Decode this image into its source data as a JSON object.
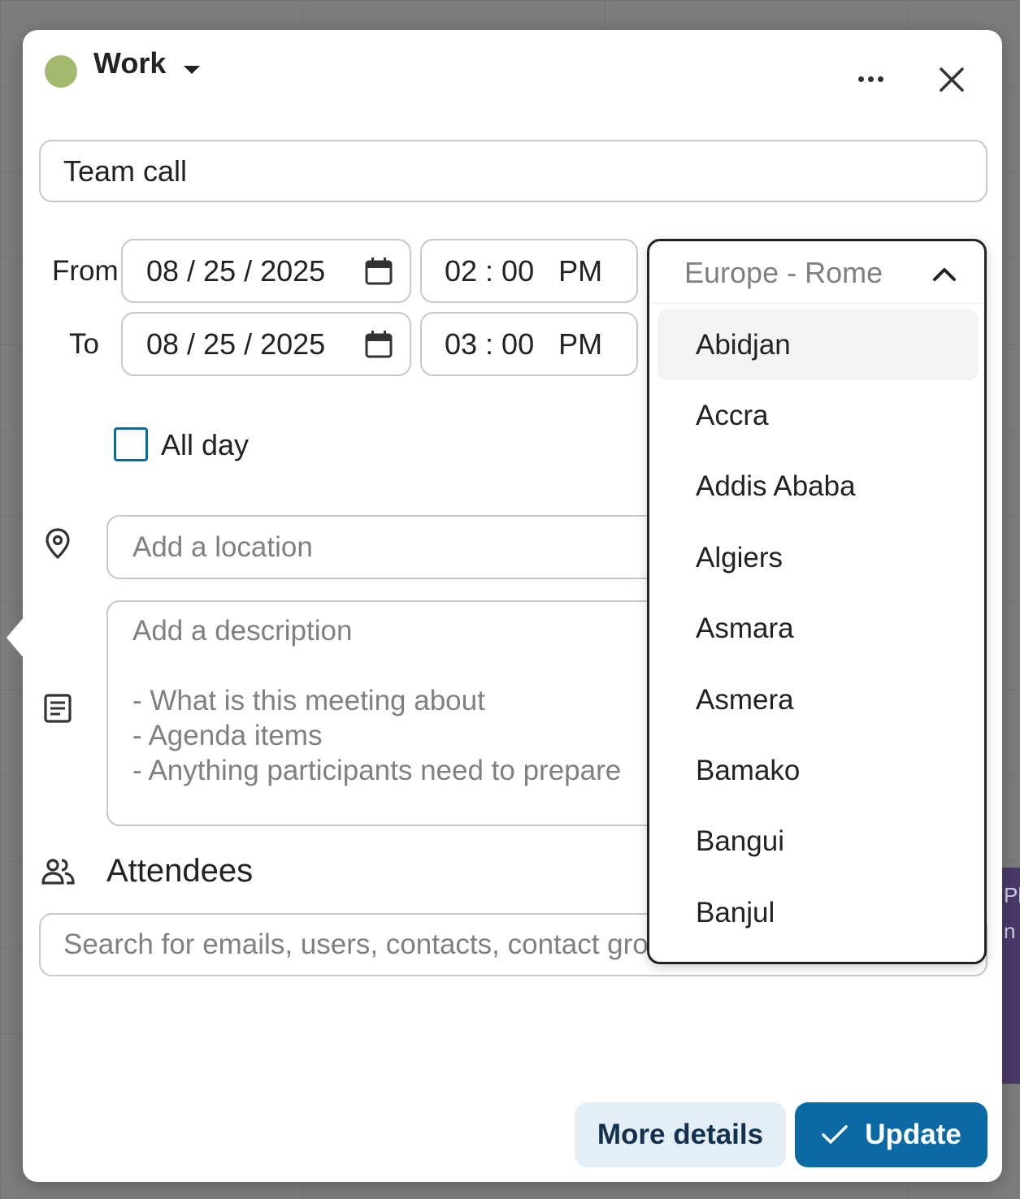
{
  "background": {
    "event_fragment": "Pl n"
  },
  "header": {
    "calendar_name": "Work",
    "calendar_color": "#a3b96e",
    "more_icon": "more-horizontal-icon",
    "close_icon": "close-icon"
  },
  "event": {
    "title": "Team call"
  },
  "from": {
    "label": "From",
    "date": "08 / 25 / 2025",
    "time": "02 : 00   PM"
  },
  "to": {
    "label": "To",
    "date": "08 / 25 / 2025",
    "time": "03 : 00   PM"
  },
  "timezone": {
    "value": "Europe - Rome",
    "options": [
      "Abidjan",
      "Accra",
      "Addis Ababa",
      "Algiers",
      "Asmara",
      "Asmera",
      "Bamako",
      "Bangui",
      "Banjul"
    ]
  },
  "all_day": {
    "label": "All day",
    "checked": false
  },
  "location": {
    "placeholder": "Add a location"
  },
  "description": {
    "placeholder_lines": [
      "Add a description",
      "",
      "- What is this meeting about",
      "- Agenda items",
      "- Anything participants need to prepare"
    ]
  },
  "attendees": {
    "label": "Attendees",
    "placeholder": "Search for emails, users, contacts, contact groups or teams"
  },
  "buttons": {
    "more_details": "More details",
    "update": "Update"
  },
  "colors": {
    "primary": "#0b6aa3",
    "secondary_bg": "#e4eef6"
  }
}
